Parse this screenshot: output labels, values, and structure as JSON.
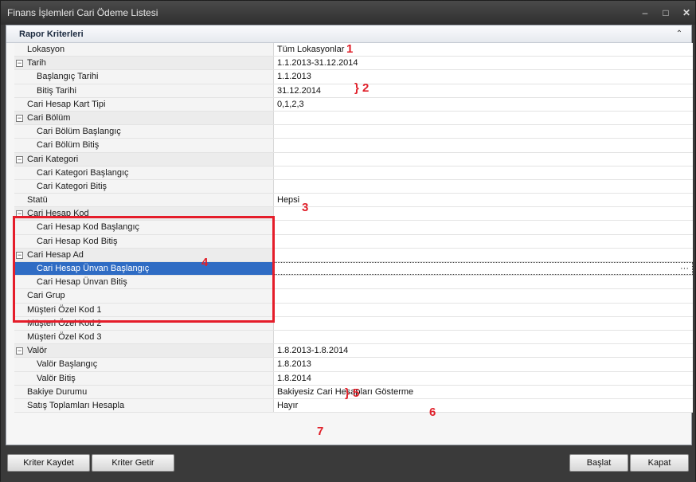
{
  "window": {
    "title": "Finans İşlemleri Cari Ödeme Listesi",
    "minimize_glyph": "–",
    "maximize_glyph": "□",
    "close_glyph": "✕"
  },
  "group": {
    "title": "Rapor Kriterleri",
    "collapse_glyph": "⌃"
  },
  "rows": [
    {
      "label": "Lokasyon",
      "value": "Tüm Lokasyonlar",
      "level": 0,
      "expander": false
    },
    {
      "label": "Tarih",
      "value": "1.1.2013-31.12.2014",
      "level": 0,
      "expander": true
    },
    {
      "label": "Başlangıç Tarihi",
      "value": "1.1.2013",
      "level": 1,
      "expander": false
    },
    {
      "label": "Bitiş Tarihi",
      "value": "31.12.2014",
      "level": 1,
      "expander": false
    },
    {
      "label": "Cari Hesap Kart Tipi",
      "value": "0,1,2,3",
      "level": 0,
      "expander": false
    },
    {
      "label": "Cari Bölüm",
      "value": "",
      "level": 0,
      "expander": true
    },
    {
      "label": "Cari Bölüm Başlangıç",
      "value": "",
      "level": 1,
      "expander": false
    },
    {
      "label": "Cari Bölüm Bitiş",
      "value": "",
      "level": 1,
      "expander": false
    },
    {
      "label": "Cari Kategori",
      "value": "",
      "level": 0,
      "expander": true
    },
    {
      "label": "Cari Kategori Başlangıç",
      "value": "",
      "level": 1,
      "expander": false
    },
    {
      "label": "Cari Kategori Bitiş",
      "value": "",
      "level": 1,
      "expander": false
    },
    {
      "label": "Statü",
      "value": "Hepsi",
      "level": 0,
      "expander": false
    },
    {
      "label": "Cari Hesap Kod",
      "value": "",
      "level": 0,
      "expander": true
    },
    {
      "label": "Cari Hesap Kod Başlangıç",
      "value": "",
      "level": 1,
      "expander": false
    },
    {
      "label": "Cari Hesap Kod Bitiş",
      "value": "",
      "level": 1,
      "expander": false
    },
    {
      "label": "Cari Hesap Ad",
      "value": "",
      "level": 0,
      "expander": true
    },
    {
      "label": "Cari Hesap Ünvan Başlangıç",
      "value": "",
      "level": 1,
      "expander": false,
      "selected": true
    },
    {
      "label": "Cari Hesap Ünvan Bitiş",
      "value": "",
      "level": 1,
      "expander": false
    },
    {
      "label": "Cari Grup",
      "value": "",
      "level": 0,
      "expander": false
    },
    {
      "label": "Müşteri Özel Kod 1",
      "value": "",
      "level": 0,
      "expander": false
    },
    {
      "label": "Müşteri Özel Kod 2",
      "value": "",
      "level": 0,
      "expander": false
    },
    {
      "label": "Müşteri Özel Kod 3",
      "value": "",
      "level": 0,
      "expander": false
    },
    {
      "label": "Valör",
      "value": "1.8.2013-1.8.2014",
      "level": 0,
      "expander": true
    },
    {
      "label": "Valör Başlangıç",
      "value": "1.8.2013",
      "level": 1,
      "expander": false
    },
    {
      "label": "Valör Bitiş",
      "value": "1.8.2014",
      "level": 1,
      "expander": false
    },
    {
      "label": "Bakiye Durumu",
      "value": "Bakiyesiz Cari Hesapları Gösterme",
      "level": 0,
      "expander": false
    },
    {
      "label": "Satış Toplamları Hesapla",
      "value": "Hayır",
      "level": 0,
      "expander": false
    }
  ],
  "expander_glyph": "−",
  "ellipsis": "···",
  "annotations": {
    "a1": "1",
    "a2": "} 2",
    "a3": "3",
    "a4": "4",
    "a5": "} 5",
    "a6": "6",
    "a7": "7"
  },
  "buttons": {
    "save_criteria": "Kriter Kaydet",
    "load_criteria": "Kriter Getir",
    "start": "Başlat",
    "close": "Kapat"
  },
  "colors": {
    "selection": "#2f6cc4",
    "annotation": "#e51d2a"
  }
}
